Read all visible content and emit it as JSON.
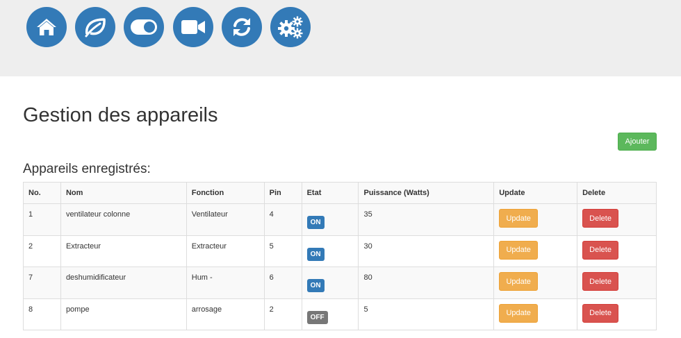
{
  "nav": {
    "items": [
      {
        "icon": "home-icon"
      },
      {
        "icon": "leaf-icon"
      },
      {
        "icon": "toggle-icon"
      },
      {
        "icon": "video-camera-icon"
      },
      {
        "icon": "refresh-icon"
      },
      {
        "icon": "gears-icon"
      }
    ]
  },
  "page": {
    "title": "Gestion des appareils",
    "add_label": "Ajouter",
    "section_title": "Appareils enregistrés:"
  },
  "table": {
    "headers": [
      "No.",
      "Nom",
      "Fonction",
      "Pin",
      "Etat",
      "Puissance (Watts)",
      "Update",
      "Delete"
    ],
    "rows": [
      {
        "no": "1",
        "nom": "ventilateur colonne",
        "fonction": "Ventilateur",
        "pin": "4",
        "etat": "ON",
        "puissance": "35",
        "update": "Update",
        "delete": "Delete"
      },
      {
        "no": "2",
        "nom": "Extracteur",
        "fonction": "Extracteur",
        "pin": "5",
        "etat": "ON",
        "puissance": "30",
        "update": "Update",
        "delete": "Delete"
      },
      {
        "no": "7",
        "nom": "deshumidificateur",
        "fonction": "Hum -",
        "pin": "6",
        "etat": "ON",
        "puissance": "80",
        "update": "Update",
        "delete": "Delete"
      },
      {
        "no": "8",
        "nom": "pompe",
        "fonction": "arrosage",
        "pin": "2",
        "etat": "OFF",
        "puissance": "5",
        "update": "Update",
        "delete": "Delete"
      }
    ]
  },
  "colors": {
    "primary": "#337ab7",
    "success": "#5cb85c",
    "warning": "#f0ad4e",
    "danger": "#d9534f",
    "off": "#777777"
  }
}
